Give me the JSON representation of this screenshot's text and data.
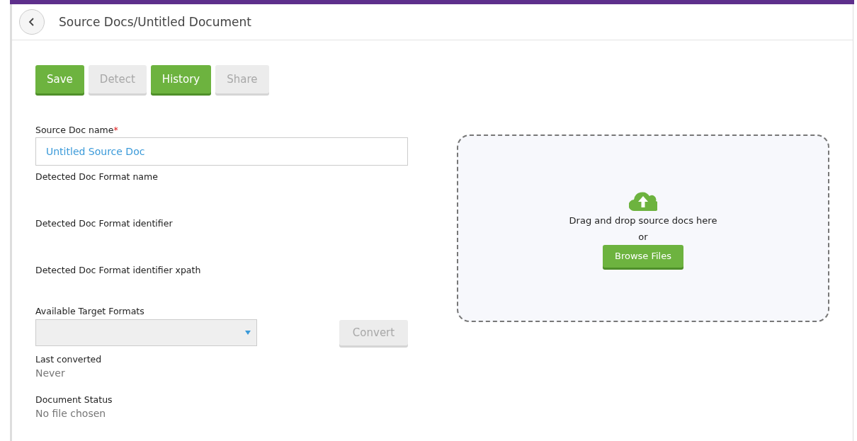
{
  "header": {
    "title": "Source Docs/Untitled Document"
  },
  "toolbar": [
    {
      "label": "Save",
      "disabled": false
    },
    {
      "label": "Detect",
      "disabled": true
    },
    {
      "label": "History",
      "disabled": false
    },
    {
      "label": "Share",
      "disabled": true
    }
  ],
  "name_field": {
    "label": "Source Doc name",
    "required": true,
    "required_mark": "*",
    "value": "Untitled Source Doc"
  },
  "detected": [
    {
      "label": "Detected Doc Format name"
    },
    {
      "label": "Detected Doc Format identifier"
    },
    {
      "label": "Detected Doc Format identifier xpath"
    }
  ],
  "target_formats": {
    "label": "Available Target Formats",
    "convert": {
      "label": "Convert",
      "disabled": true
    }
  },
  "info": [
    {
      "label": "Last converted",
      "value": "Never"
    },
    {
      "label": "Document Status",
      "value": "No file chosen"
    }
  ],
  "dropzone": {
    "text": "Drag and drop source docs here",
    "or": "or",
    "button": "Browse Files"
  }
}
